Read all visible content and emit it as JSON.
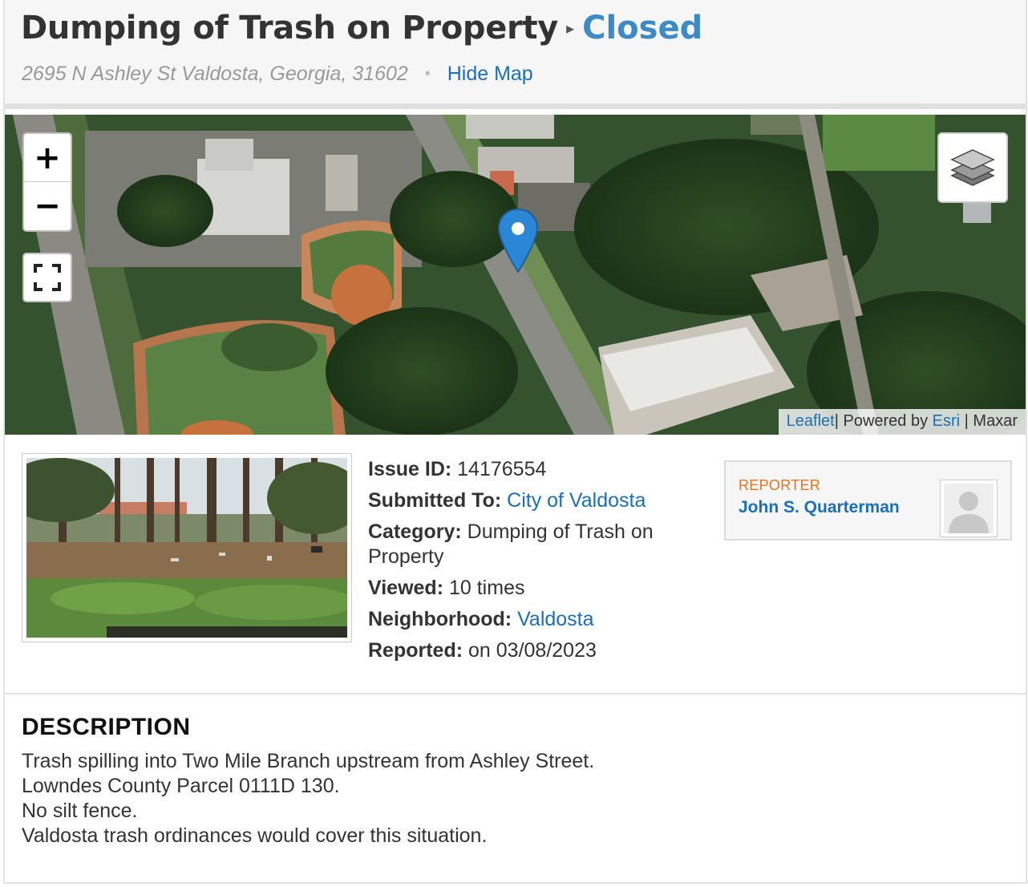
{
  "issue": {
    "title": "Dumping of Trash on Property",
    "status": "Closed",
    "address": "2695 N Ashley St Valdosta, Georgia, 31602",
    "hide_map_label": "Hide Map"
  },
  "map": {
    "zoom_in": "+",
    "zoom_out": "−",
    "attribution": {
      "leaflet": "Leaflet",
      "powered_by": "| Powered by ",
      "esri": "Esri",
      "maxar": " | Maxar"
    },
    "icons": [
      "zoom-in-icon",
      "zoom-out-icon",
      "fullscreen-icon",
      "layers-icon",
      "map-marker-icon"
    ]
  },
  "details": {
    "issue_id_label": "Issue ID:",
    "issue_id": "14176554",
    "submitted_to_label": "Submitted To:",
    "submitted_to": "City of Valdosta",
    "category_label": "Category:",
    "category": "Dumping of Trash on Property",
    "viewed_label": "Viewed:",
    "viewed": "10 times",
    "neighborhood_label": "Neighborhood:",
    "neighborhood": "Valdosta",
    "reported_label": "Reported:",
    "reported": "on 03/08/2023"
  },
  "reporter": {
    "label": "REPORTER",
    "name": "John S. Quarterman"
  },
  "description": {
    "heading": "DESCRIPTION",
    "lines": [
      "Trash spilling into Two Mile Branch upstream from Ashley Street.",
      "Lowndes County Parcel 0111D 130.",
      "No silt fence.",
      "Valdosta trash ordinances would cover this situation."
    ]
  },
  "colors": {
    "link": "#1a6fb5",
    "status": "#3d8ac4",
    "reporter_label": "#e8721c"
  }
}
